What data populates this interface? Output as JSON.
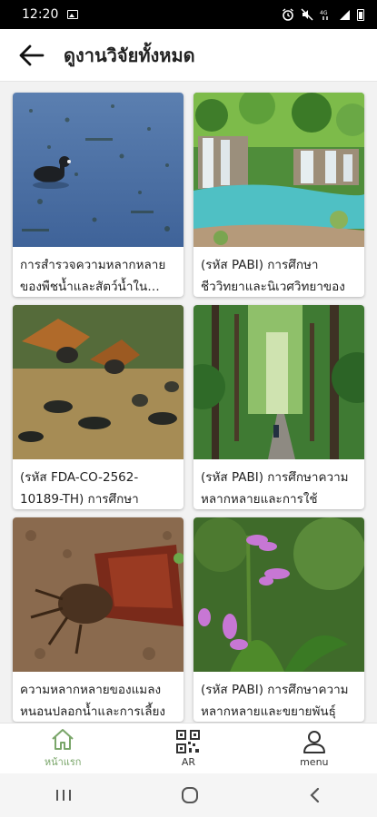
{
  "status": {
    "time": "12:20",
    "icons": [
      "image-icon",
      "alarm-icon",
      "mute-icon",
      "volte-icon",
      "signal-icon",
      "battery-icon"
    ]
  },
  "header": {
    "title": "ดูงานวิจัยทั้งหมด",
    "back_icon": "arrow-left-icon"
  },
  "cards": [
    {
      "text": "การสำรวจความหลากหลายของพืชน้ำและสัตว์น้ำในกาญจนบุรี",
      "image": "waterbird-on-lake"
    },
    {
      "text": "(รหัส PABI) การศึกษาชีววิทยาและนิเวศวิทยาของ",
      "image": "waterfall-pool"
    },
    {
      "text": "(รหัส FDA-CO-2562-10189-TH) การศึกษา",
      "image": "peafowl-flock"
    },
    {
      "text": "(รหัส PABI) การศึกษาความหลากหลายและการใช้",
      "image": "forest-path"
    },
    {
      "text": "ความหลากหลายของแมลงหนอนปลอกน้ำและการเลี้ยง",
      "image": "insect-closeup"
    },
    {
      "text": "(รหัส PABI) การศึกษาความหลากหลายและขยายพันธุ์",
      "image": "purple-orchid"
    }
  ],
  "bottom_nav": [
    {
      "label": "หน้าแรก",
      "icon": "home-icon",
      "active": true
    },
    {
      "label": "AR",
      "icon": "qr-code-icon",
      "active": false
    },
    {
      "label": "menu",
      "icon": "person-icon",
      "active": false
    }
  ],
  "colors": {
    "accent": "#7aa66a",
    "status_bar": "#000000",
    "background": "#f2f2f2"
  }
}
